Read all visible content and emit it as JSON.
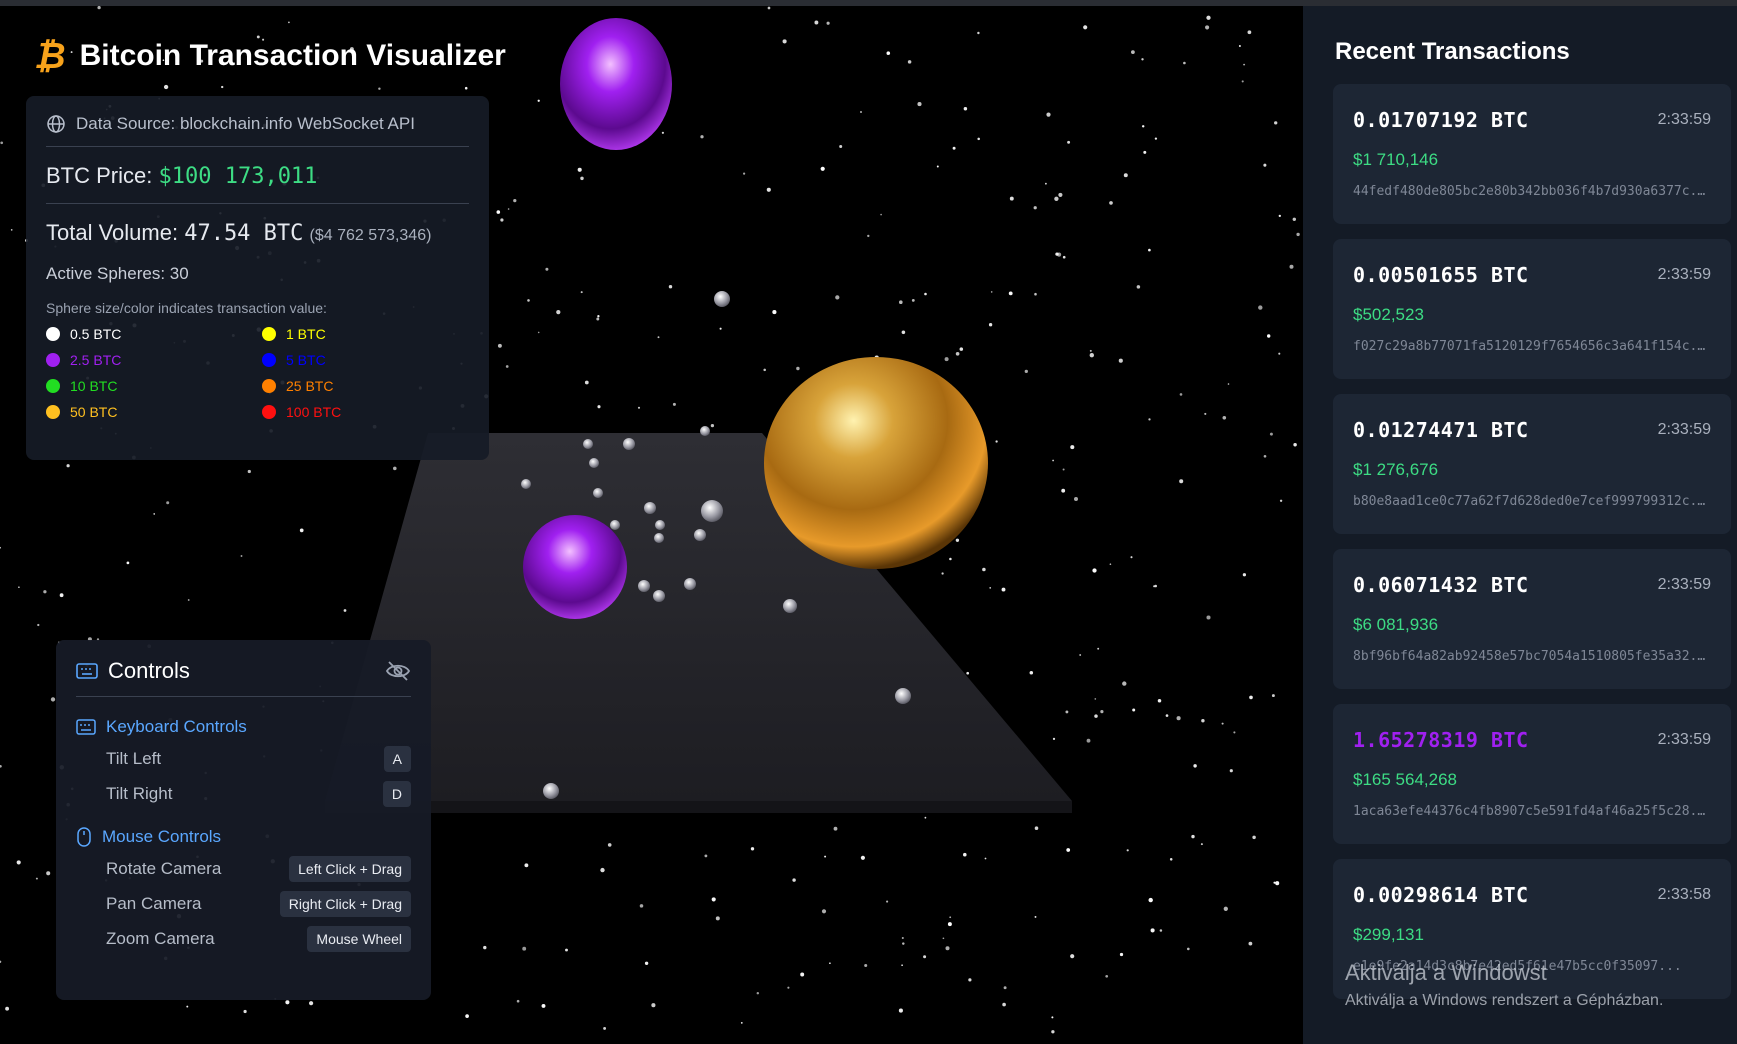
{
  "app": {
    "title": "Bitcoin Transaction Visualizer",
    "icon": "bitcoin-icon",
    "icon_glyph": "₿"
  },
  "info": {
    "source_label": "Data Source: blockchain.info WebSocket API",
    "price_label": "BTC Price:",
    "price_value": "$100 173,011",
    "volume_label": "Total Volume:",
    "volume_value": "47.54 BTC",
    "volume_usd": "($4 762 573,346)",
    "active_spheres": "Active Spheres: 30",
    "legend_caption": "Sphere size/color indicates transaction value:",
    "legend": [
      {
        "label": "0.5 BTC",
        "color": "#ffffff"
      },
      {
        "label": "1 BTC",
        "color": "#ffff00"
      },
      {
        "label": "2.5 BTC",
        "color": "#a020f0"
      },
      {
        "label": "5 BTC",
        "color": "#0000ff"
      },
      {
        "label": "10 BTC",
        "color": "#22dd22"
      },
      {
        "label": "25 BTC",
        "color": "#ff8000"
      },
      {
        "label": "50 BTC",
        "color": "#ffc020"
      },
      {
        "label": "100 BTC",
        "color": "#ff1010"
      }
    ]
  },
  "controls": {
    "title": "Controls",
    "keyboard_title": "Keyboard Controls",
    "keyboard": [
      {
        "action": "Tilt Left",
        "key": "A"
      },
      {
        "action": "Tilt Right",
        "key": "D"
      }
    ],
    "mouse_title": "Mouse Controls",
    "mouse": [
      {
        "action": "Rotate Camera",
        "key": "Left Click + Drag"
      },
      {
        "action": "Pan Camera",
        "key": "Right Click + Drag"
      },
      {
        "action": "Zoom Camera",
        "key": "Mouse Wheel"
      }
    ]
  },
  "sidebar": {
    "title": "Recent Transactions",
    "transactions": [
      {
        "amount": "0.01707192 BTC",
        "time": "2:33:59",
        "usd": "$1 710,146",
        "hash": "44fedf480de805bc2e80b342bb036f4b7d930a6377c..."
      },
      {
        "amount": "0.00501655 BTC",
        "time": "2:33:59",
        "usd": "$502,523",
        "hash": "f027c29a8b77071fa5120129f7654656c3a641f154c..."
      },
      {
        "amount": "0.01274471 BTC",
        "time": "2:33:59",
        "usd": "$1 276,676",
        "hash": "b80e8aad1ce0c77a62f7d628ded0e7cef999799312c..."
      },
      {
        "amount": "0.06071432 BTC",
        "time": "2:33:59",
        "usd": "$6 081,936",
        "hash": "8bf96bf64a82ab92458e57bc7054a1510805fe35a32..."
      },
      {
        "amount": "1.65278319 BTC",
        "time": "2:33:59",
        "usd": "$165 564,268",
        "hash": "1aca63efe44376c4fb8907c5e591fd4af46a25f5c28...",
        "highlight": "#a020f0"
      },
      {
        "amount": "0.00298614 BTC",
        "time": "2:33:58",
        "usd": "$299,131",
        "hash": "e1e9fe2a14d3c8b7e42ed5f61e47b5cc0f35097..."
      }
    ]
  },
  "watermark": {
    "line1": "Aktiválja a Windowst",
    "line2": "Aktiválja a Windows rendszert a Gépházban."
  }
}
